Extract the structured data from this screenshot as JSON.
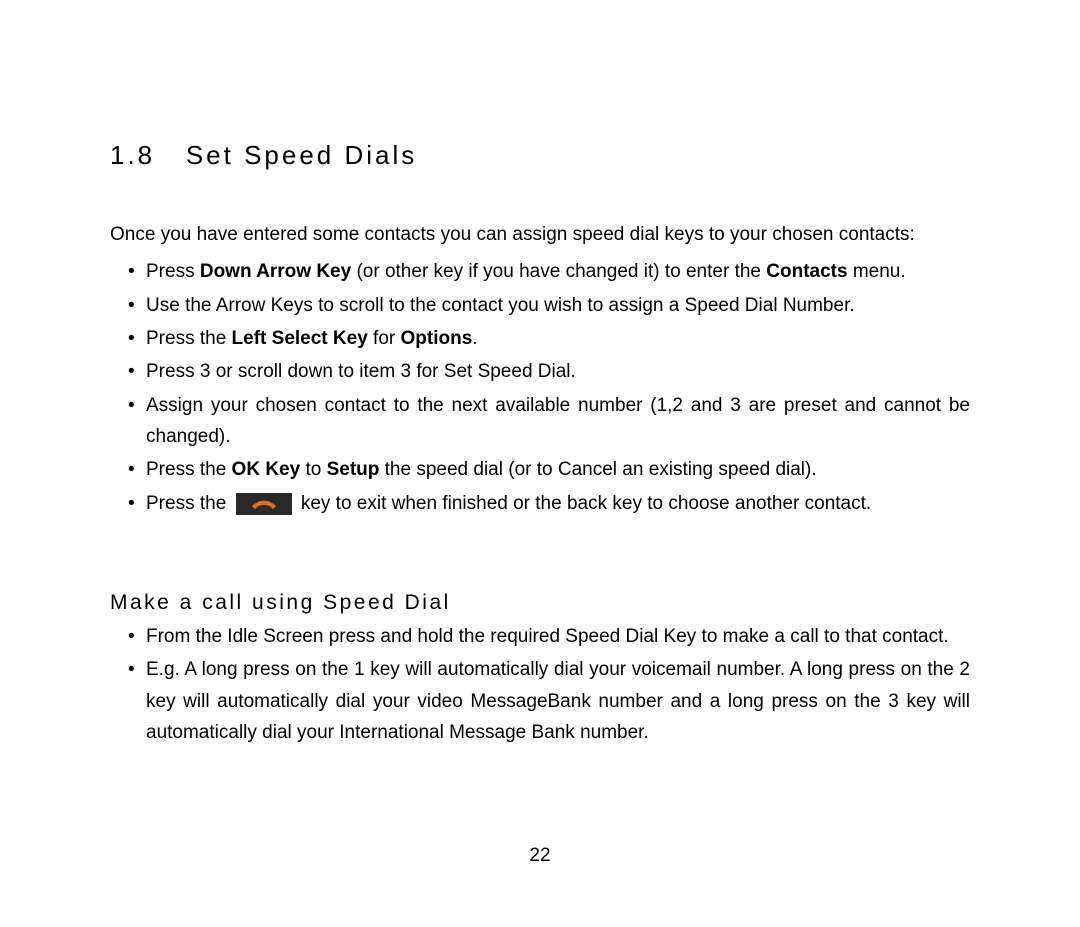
{
  "heading": {
    "number": "1.8",
    "title": "Set Speed Dials"
  },
  "intro": "Once you have entered some contacts you can assign speed dial keys to your chosen contacts:",
  "bullets1": {
    "b1_pre": "Press ",
    "b1_bold1": "Down Arrow Key",
    "b1_mid": " (or other key if you have changed it) to enter the ",
    "b1_bold2": "Contacts",
    "b1_post": " menu.",
    "b2": "Use the Arrow Keys to scroll to the contact you wish to assign a Speed Dial Number.",
    "b3_pre": "Press the ",
    "b3_bold1": "Left Select Key",
    "b3_mid": " for ",
    "b3_bold2": "Options",
    "b3_post": ".",
    "b4": "Press 3 or scroll down to item 3 for Set Speed Dial.",
    "b5": "Assign your chosen contact to the next available number (1,2 and 3 are preset and cannot be changed).",
    "b6_pre": "Press the ",
    "b6_bold1": "OK Key",
    "b6_mid": " to ",
    "b6_bold2": "Setup",
    "b6_post": " the speed dial (or to Cancel an existing speed dial).",
    "b7_pre": "Press the ",
    "b7_post": " key to exit when finished or the back key to choose another contact."
  },
  "subheading": "Make a call using Speed Dial",
  "bullets2": {
    "b1": "From the Idle Screen press and hold the required Speed Dial Key to make a call to that contact.",
    "b2": "E.g. A long press on the 1 key will automatically dial your voicemail number. A long press on the 2 key will automatically dial your video MessageBank number and a long press on the 3 key will automatically dial your International Message Bank number."
  },
  "page_number": "22"
}
